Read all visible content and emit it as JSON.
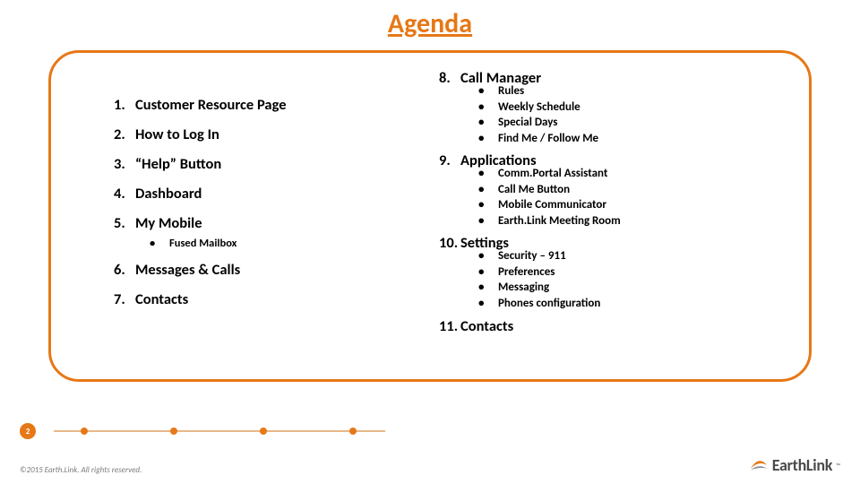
{
  "title": "Agenda",
  "left": [
    {
      "num": "1.",
      "label": "Customer Resource Page"
    },
    {
      "num": "2.",
      "label": "How to Log In"
    },
    {
      "num": "3.",
      "label": "“Help” Button"
    },
    {
      "num": "4.",
      "label": "Dashboard"
    },
    {
      "num": "5.",
      "label": "My Mobile",
      "sub": [
        "Fused Mailbox"
      ]
    },
    {
      "num": "6.",
      "label": "Messages & Calls"
    },
    {
      "num": "7.",
      "label": "Contacts"
    }
  ],
  "right": [
    {
      "num": "8.",
      "label": "Call Manager",
      "sub": [
        "Rules",
        "Weekly Schedule",
        "Special Days",
        "Find Me  / Follow Me"
      ]
    },
    {
      "num": "9.",
      "label": "Applications",
      "sub": [
        "Comm.Portal Assistant",
        "Call Me Button",
        "Mobile Communicator",
        "Earth.Link Meeting Room"
      ]
    },
    {
      "num": "10.",
      "label": "Settings",
      "sub": [
        "Security – 911",
        "Preferences",
        "Messaging",
        "Phones configuration"
      ]
    },
    {
      "num": "11.",
      "label": "Contacts"
    }
  ],
  "page_number": "2",
  "copyright": "©2015 Earth.Link. All rights reserved.",
  "logo_text": "EarthLink",
  "logo_tm": "™"
}
